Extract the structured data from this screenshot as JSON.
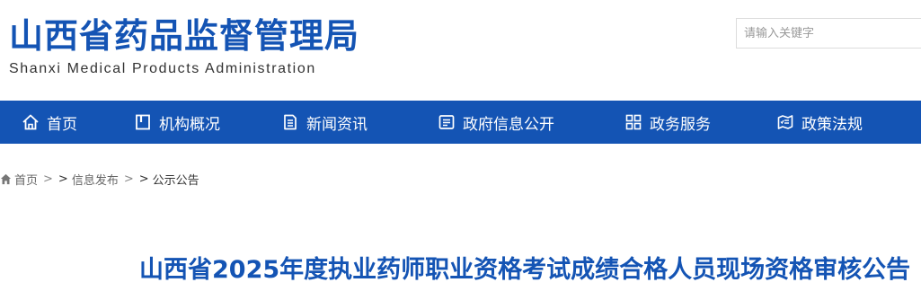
{
  "header": {
    "logo_cn": "山西省药品监督管理局",
    "logo_en": "Shanxi Medical Products Administration",
    "search_placeholder": "请输入关键字"
  },
  "nav": {
    "items": [
      {
        "label": "首页",
        "icon": "home-icon"
      },
      {
        "label": "机构概况",
        "icon": "document-icon"
      },
      {
        "label": "新闻资讯",
        "icon": "news-icon"
      },
      {
        "label": "政府信息公开",
        "icon": "info-board-icon"
      },
      {
        "label": "政务服务",
        "icon": "grid-icon"
      },
      {
        "label": "政策法规",
        "icon": "policy-icon"
      }
    ]
  },
  "breadcrumb": {
    "home": "首页",
    "level1": "信息发布",
    "current": "公示公告",
    "separator": ">",
    "arrow": ">"
  },
  "article": {
    "title": "山西省2025年度执业药师职业资格考试成绩合格人员现场资格审核公告"
  },
  "colors": {
    "brand_blue": "#1454b4",
    "text_dark": "#333333",
    "text_muted": "#666666"
  }
}
